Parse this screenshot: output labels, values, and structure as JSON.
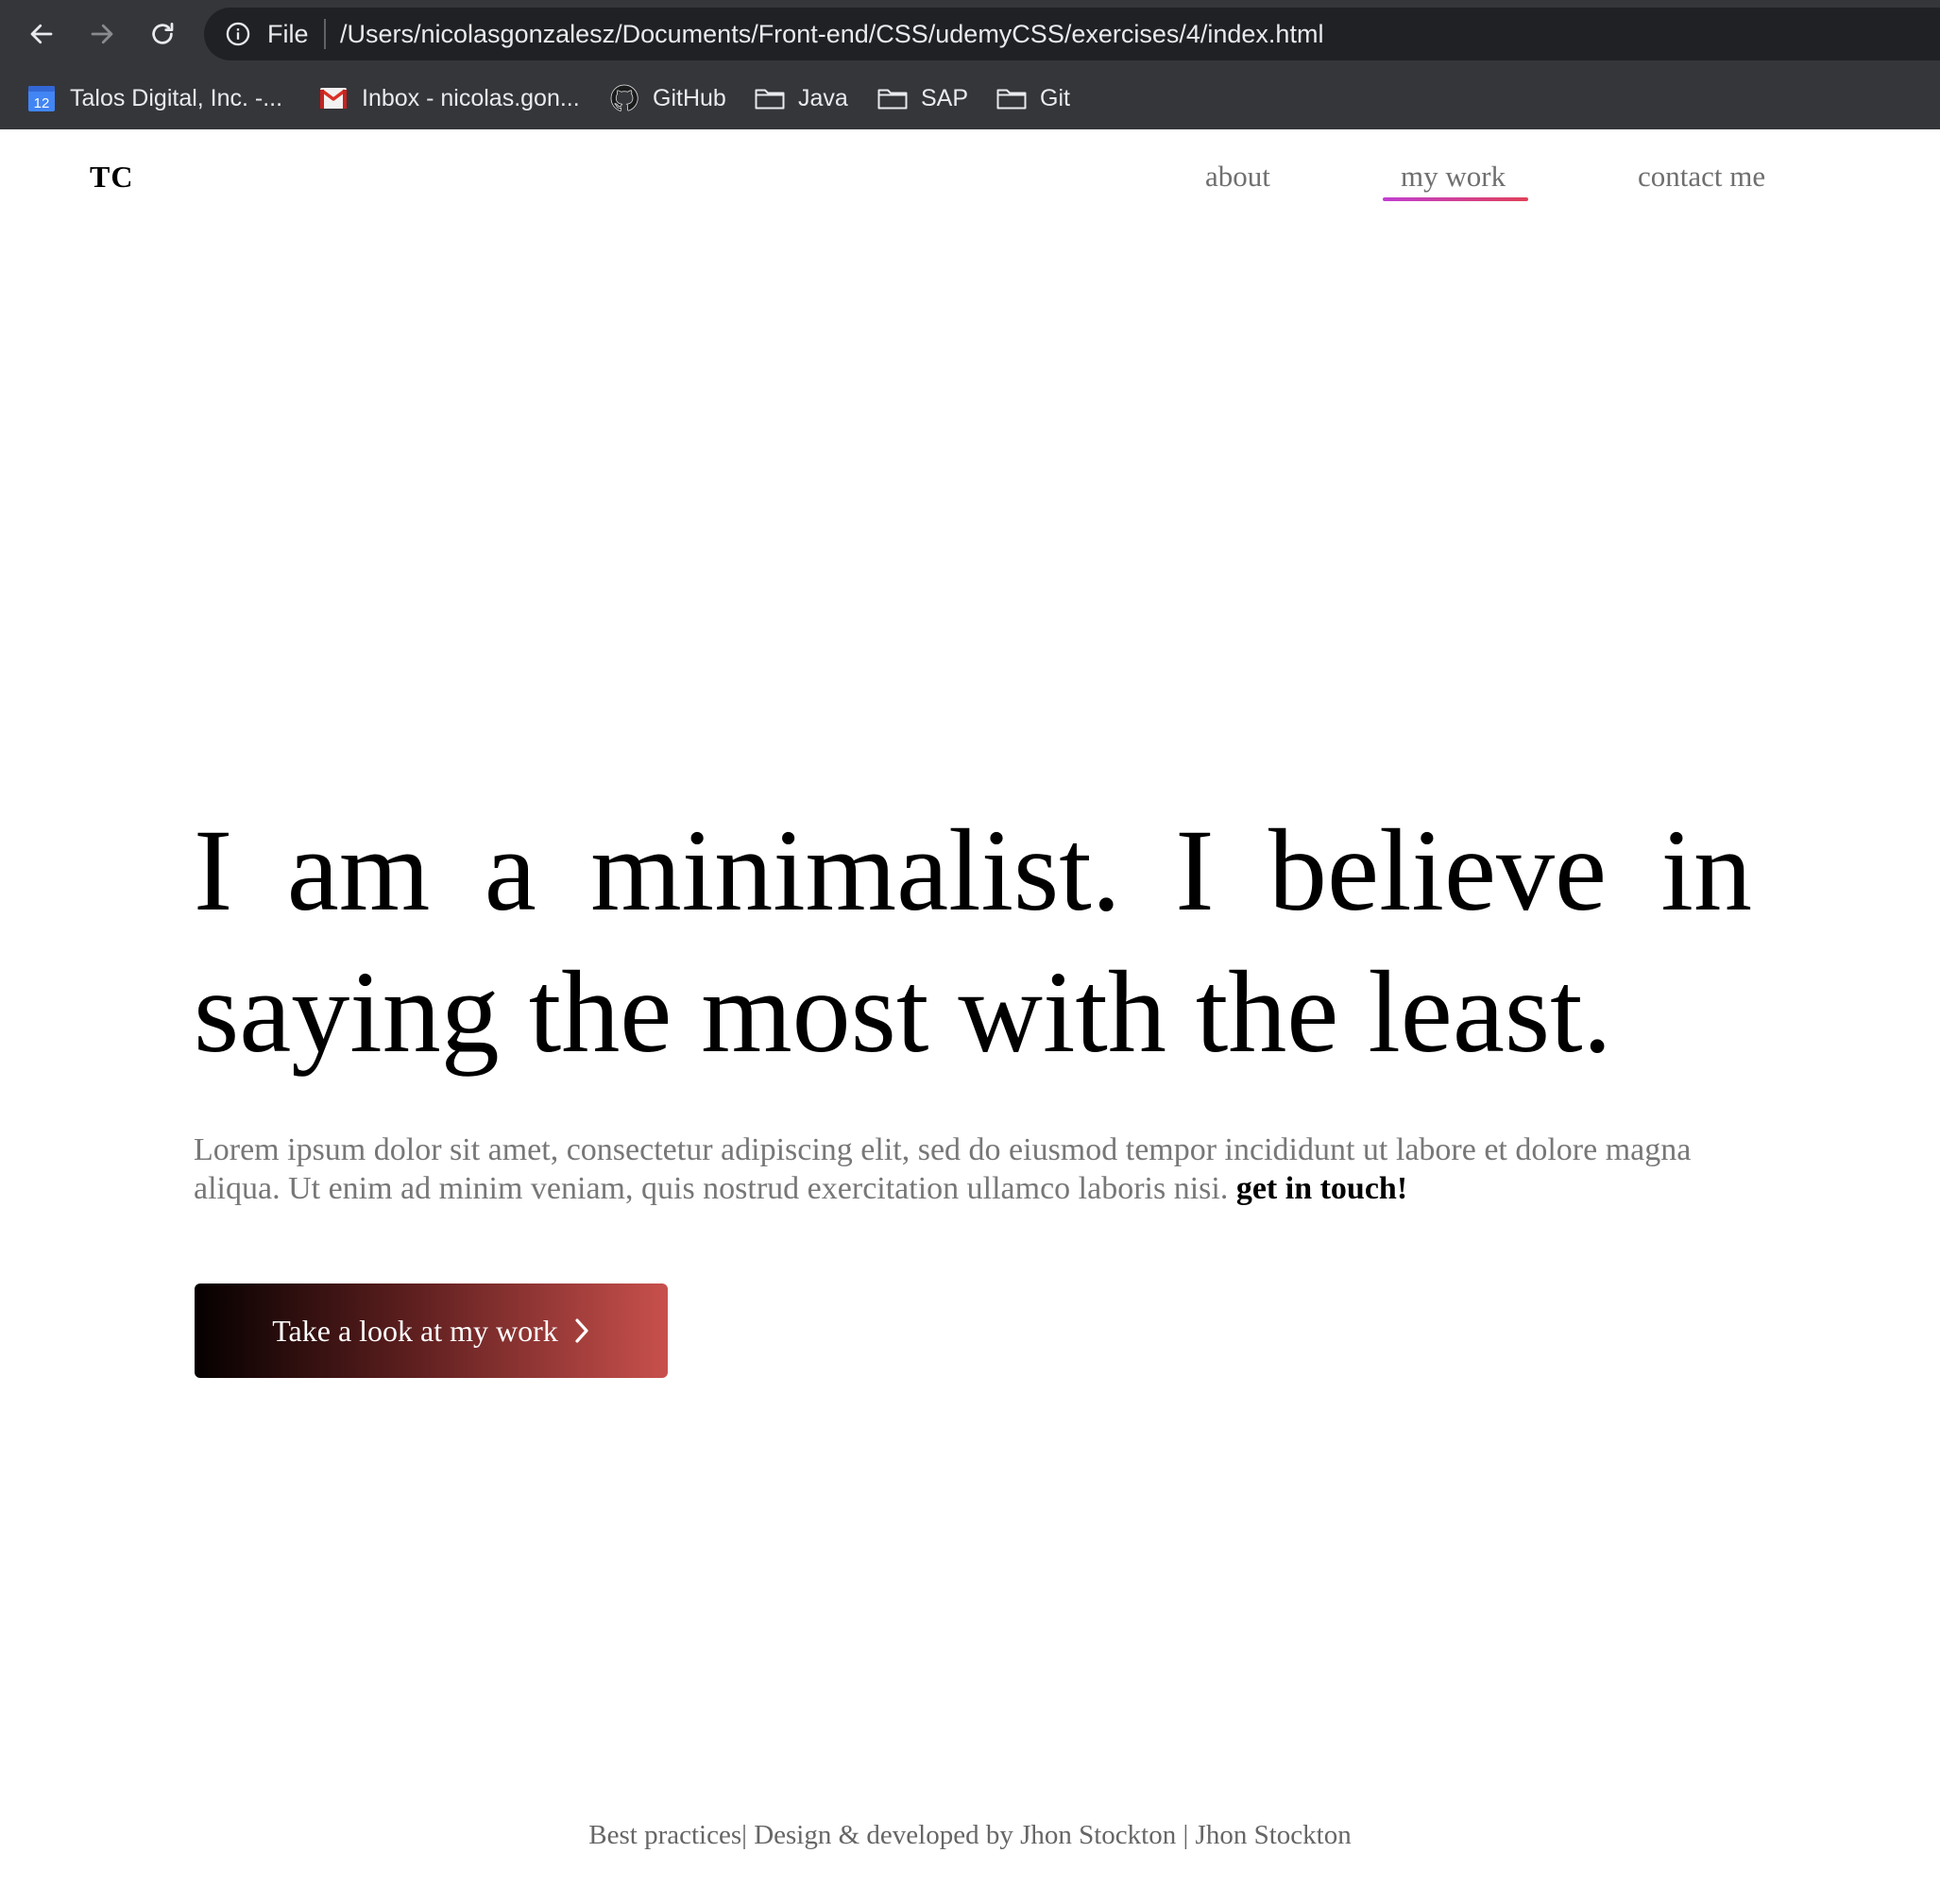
{
  "browser": {
    "icons": {
      "back": "arrow-left-icon",
      "forward": "arrow-right-icon",
      "reload": "reload-icon",
      "info": "info-icon"
    },
    "address_scheme": "File",
    "address_url": "/Users/nicolasgonzalesz/Documents/Front-end/CSS/udemyCSS/exercises/4/index.html",
    "bookmarks": [
      {
        "label": "Talos Digital, Inc. -...",
        "icon": "calendar-icon"
      },
      {
        "label": "Inbox - nicolas.gon...",
        "icon": "gmail-icon"
      },
      {
        "label": "GitHub",
        "icon": "github-icon"
      },
      {
        "label": "Java",
        "icon": "folder-icon"
      },
      {
        "label": "SAP",
        "icon": "folder-icon"
      },
      {
        "label": "Git",
        "icon": "folder-icon"
      }
    ],
    "calendar_day": "12"
  },
  "site": {
    "logo": "TC",
    "nav": [
      {
        "label": "about",
        "active": false
      },
      {
        "label": "my work",
        "active": true
      },
      {
        "label": "contact me",
        "active": false
      }
    ],
    "nav_underline_colors": [
      "#c13fd1",
      "#e0405a"
    ]
  },
  "hero": {
    "title": "I am a minimalist. I believe in saying the most with the least.",
    "text": "Lorem ipsum dolor sit amet, consectetur adipiscing elit, sed do eiusmod tempor incididunt ut labore et dolore magna aliqua. Ut enim ad minim veniam, quis nostrud exercitation ullamco laboris nisi.",
    "cta_link": "get in touch!",
    "button_label": "Take a look at my work",
    "button_icon": "chevron-right-icon",
    "button_gradient": [
      "#050000",
      "#5c1e1e",
      "#c8504c"
    ]
  },
  "footer": {
    "text": "Best practices| Design & developed by Jhon Stockton | Jhon Stockton"
  },
  "colors": {
    "chrome_bg": "#35363a",
    "omnibox_bg": "#202124",
    "nav_text": "#6f6f6f",
    "body_text": "#777777"
  }
}
